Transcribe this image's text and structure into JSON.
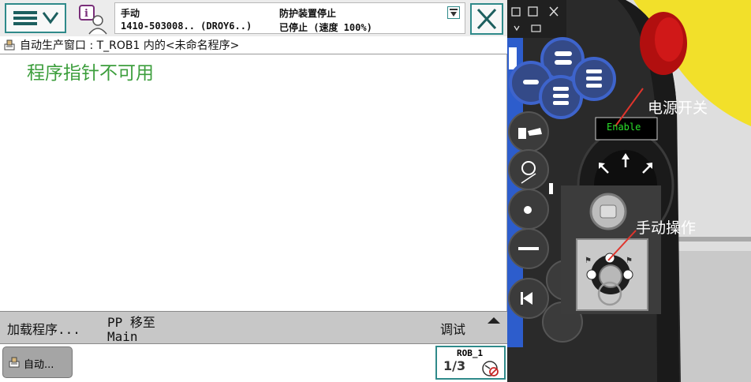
{
  "colors": {
    "accent": "#2f8a8a",
    "message_green": "#3c9e3c",
    "enable_green": "#2adf2a",
    "annotation_red": "#e0342c"
  },
  "topbar": {
    "menu_icon": "hamburger-menu-icon",
    "user_icon": "user-info-icon",
    "status": {
      "mode": "手动",
      "controller": "1410-503008.. (DROY6..)",
      "state": "防护装置停止",
      "run_state": "已停止 (速度 100%)"
    },
    "close_icon": "close-icon"
  },
  "titlebar": {
    "text": "自动生产窗口 : T_ROB1 内的<未命名程序>"
  },
  "content": {
    "message": "程序指针不可用"
  },
  "commands": {
    "load_program": "加载程序...",
    "pp_move": "PP 移至",
    "pp_target": "Main",
    "debug": "调试"
  },
  "taskbar": {
    "task_label": "自动...",
    "quickset_robot": "ROB_1",
    "quickset_increment": "1/3"
  },
  "device": {
    "enable_label": "Enable",
    "power_switch_label": "电源开关",
    "manual_mode_label": "手动操作"
  }
}
